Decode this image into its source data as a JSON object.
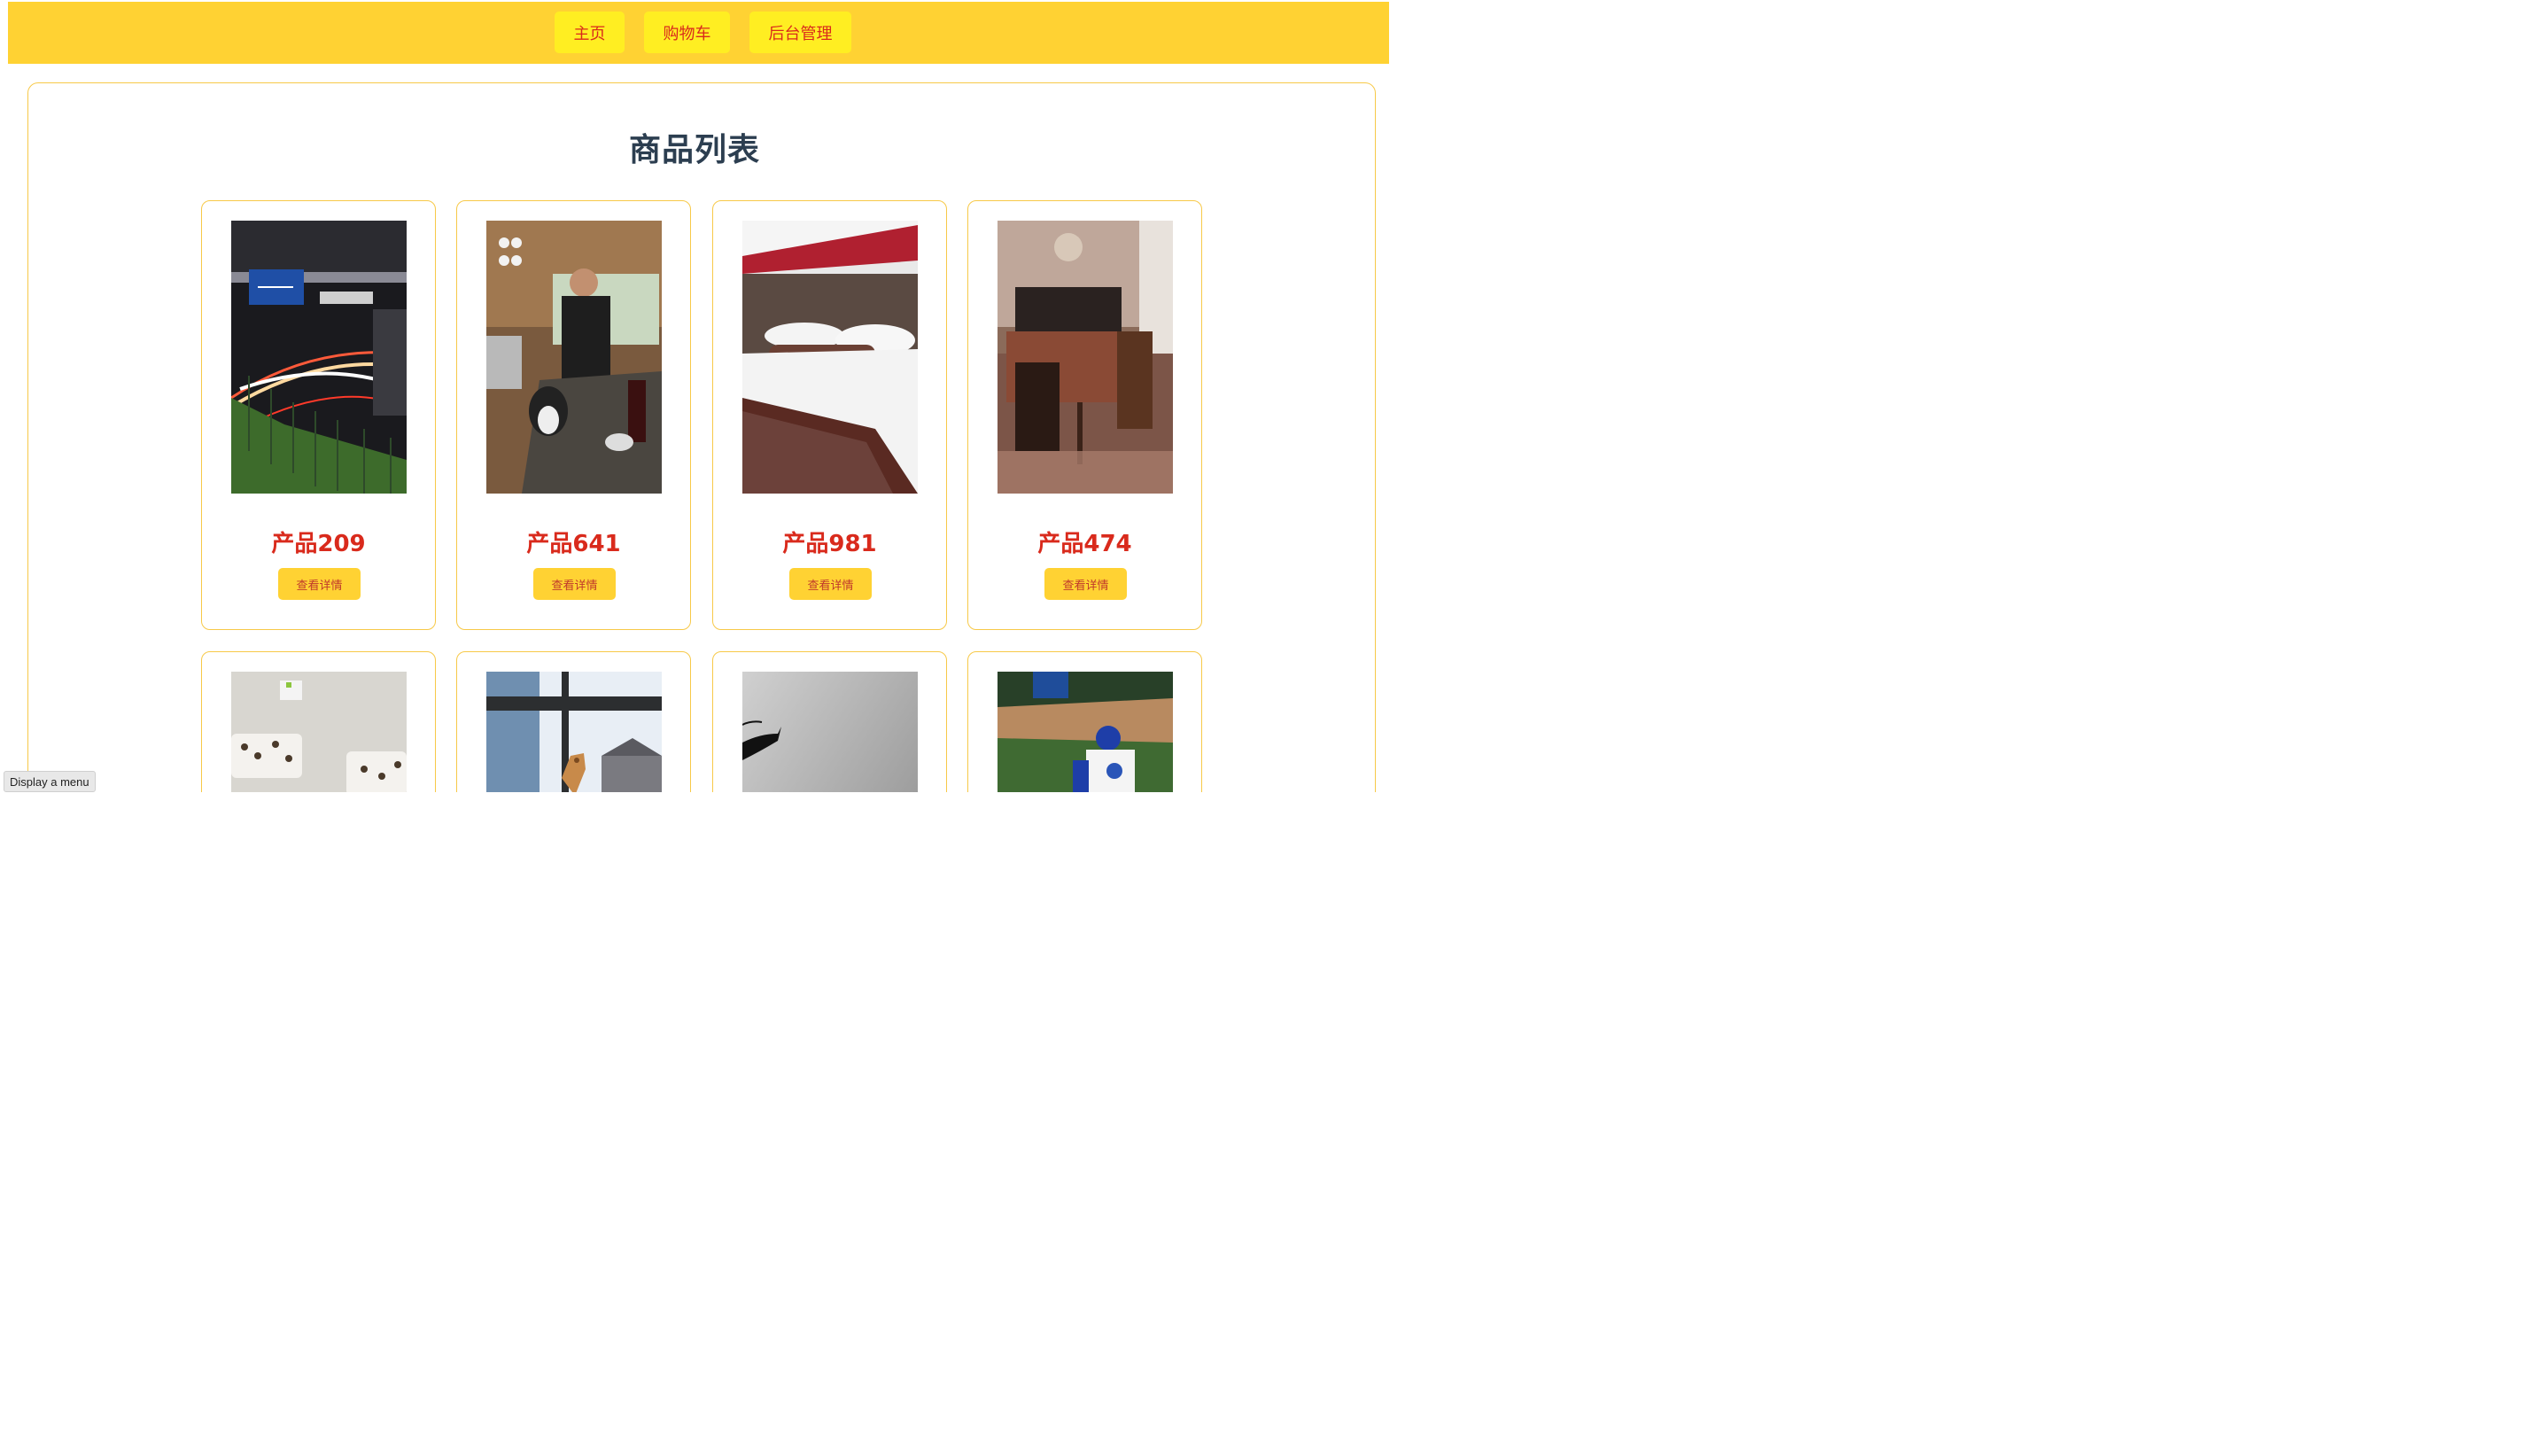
{
  "nav": {
    "home_label": "主页",
    "cart_label": "购物车",
    "admin_label": "后台管理"
  },
  "main": {
    "title": "商品列表",
    "products": [
      {
        "name": "产品209",
        "button": "查看详情",
        "image": "night-highway-photo"
      },
      {
        "name": "产品641",
        "button": "查看详情",
        "image": "man-cooking-kitchen-photo"
      },
      {
        "name": "产品981",
        "button": "查看详情",
        "image": "hotel-bed-photo"
      },
      {
        "name": "产品474",
        "button": "查看详情",
        "image": "dining-room-photo"
      },
      {
        "name": "",
        "button": "",
        "image": "bathroom-sinks-photo"
      },
      {
        "name": "",
        "button": "",
        "image": "giraffe-window-photo"
      },
      {
        "name": "",
        "button": "",
        "image": "kite-sky-photo"
      },
      {
        "name": "",
        "button": "",
        "image": "baseball-player-photo"
      }
    ]
  },
  "status": {
    "menu_hint": "Display a menu"
  },
  "colors": {
    "nav_bar": "#ffd233",
    "nav_button": "#ffee22",
    "accent_text": "#d92a1c",
    "card_border": "#f7c948",
    "title_text": "#2c3e50"
  }
}
